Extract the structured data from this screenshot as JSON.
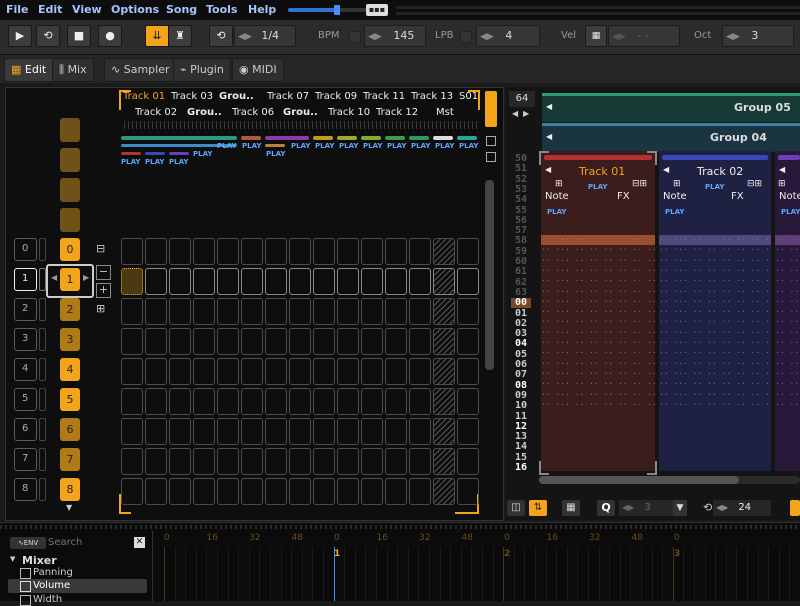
{
  "menu": [
    "File",
    "Edit",
    "View",
    "Options",
    "Song",
    "Tools",
    "Help"
  ],
  "toolbar": {
    "pattern_step": "1/4",
    "bpm_label": "BPM",
    "bpm": "145",
    "lpb_label": "LPB",
    "lpb": "4",
    "vel_label": "Vel",
    "vel": "- -",
    "oct_label": "Oct",
    "oct": "3"
  },
  "tabs": [
    "Edit",
    "Mix",
    "Sampler",
    "Plugin",
    "MIDI"
  ],
  "matrix": {
    "top_tracks": [
      "Track 01",
      "Track 03",
      "Grou..",
      "Track 07",
      "Track 09",
      "Track 11",
      "Track 13",
      "S01"
    ],
    "bottom_tracks": [
      "Track 02",
      "Grou..",
      "Track 06",
      "Grou..",
      "Track 10",
      "Track 12",
      "Mst"
    ],
    "play_label": "PLAY",
    "scene_numbers": [
      "0",
      "1",
      "2",
      "3",
      "4",
      "5",
      "6",
      "7",
      "8"
    ]
  },
  "pattern": {
    "count": "64",
    "group05": "Group 05",
    "group04": "Group 04",
    "track01": "Track 01",
    "track02": "Track 02",
    "note": "Note",
    "fx": "FX",
    "play": "PLAY",
    "rows": [
      "50",
      "51",
      "52",
      "53",
      "54",
      "55",
      "56",
      "57",
      "58",
      "59",
      "60",
      "61",
      "62",
      "63",
      "00",
      "01",
      "02",
      "03",
      "04",
      "05",
      "06",
      "07",
      "08",
      "09",
      "10",
      "11",
      "12",
      "13",
      "14",
      "15",
      "16"
    ],
    "quant": "3",
    "edit_step": "24"
  },
  "bottom": {
    "search_placeholder": "Search",
    "mixer_label": "Mixer",
    "params": [
      "Panning",
      "Volume",
      "Width"
    ],
    "ruler_ticks": [
      "0",
      "16",
      "32",
      "48",
      "0",
      "16",
      "32",
      "48",
      "0",
      "16",
      "32",
      "48",
      "0"
    ],
    "beat_markers": [
      "1",
      "2",
      "3"
    ]
  },
  "colors": {
    "accent": "#f3a41b",
    "play_blue": "#5aa6ff",
    "track01_red": "#b33232",
    "track02_blue": "#3d46b5",
    "group_green": "#2b9a7e"
  }
}
